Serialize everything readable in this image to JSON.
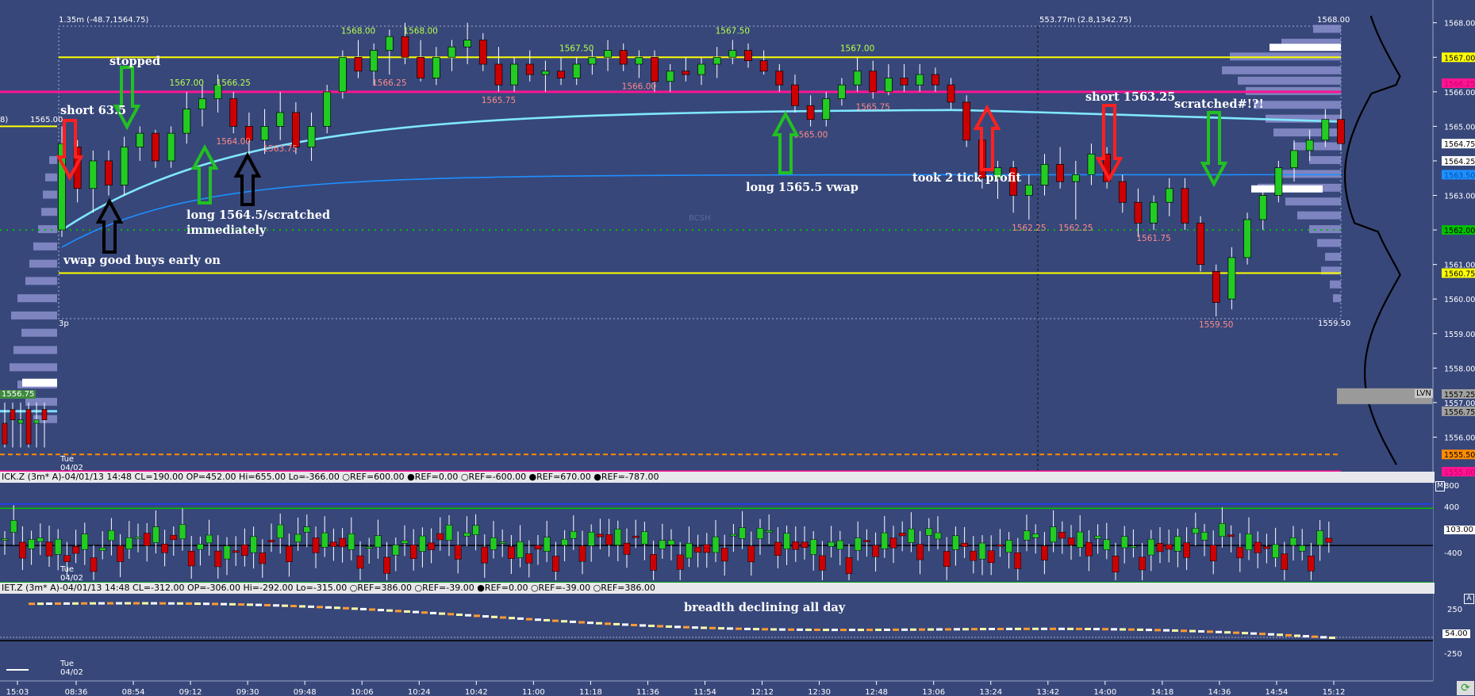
{
  "main_pane": {
    "top_left_text": "1.35m (-48.7,1564.75)",
    "top_mid_text": "553.77m (2.8,1342.75)",
    "top_right_label": "1568.00",
    "left_edge_label": "1565.00",
    "left_edge_label2": "8)",
    "bottom_right_label": "1559.50",
    "ghost_label": "BCSH",
    "date_label_day": "Tue",
    "date_label_date": "04/02",
    "three_p": "3p",
    "lvn_label": "LVN",
    "left_low_label": "1556.75"
  },
  "annotations": {
    "short_635": "short 63.5",
    "stopped": "stopped",
    "vwap_buys": "vwap good buys early on",
    "long_15645": "long 1564.5/scratched",
    "immediately": "immediately",
    "long_15655": "long 1565.5 vwap",
    "took_2_tick": "took 2 tick profit",
    "short_156325": "short 1563.25",
    "scratched": "scratched#!?!",
    "breadth": "breadth declining all day"
  },
  "tick_pane": {
    "info": "ICK.Z (3m* A)-04/01/13 14:48 CL=190.00 OP=452.00 Hi=655.00 Lo=-366.00  ○REF=600.00  ●REF=0.00  ○REF=-600.00  ●REF=670.00  ●REF=-787.00",
    "y_ticks": [
      "800",
      "400",
      "103.00",
      "-400"
    ],
    "day": "Tue",
    "date": "04/02"
  },
  "breadth_pane": {
    "info": "IET.Z (3m* A)-04/01/13 14:48 CL=-312.00 OP=-306.00 Hi=-292.00 Lo=-315.00  ○REF=386.00  ○REF=-39.00  ●REF=0.00  ○REF=-39.00  ○REF=386.00",
    "y_ticks": [
      "250",
      "-250",
      "54.00"
    ],
    "day": "Tue",
    "date": "04/02"
  },
  "price_axis": {
    "ticks": [
      "1568.00",
      "1567.00",
      "1566.00",
      "1565.00",
      "1564.00",
      "1563.00",
      "1562.00",
      "1561.00",
      "1560.00",
      "1559.00",
      "1558.00",
      "1557.00",
      "1556.00"
    ],
    "markers": [
      {
        "text": "1567.00",
        "bg": "#ffff00",
        "fg": "#000000",
        "price": 1567.0
      },
      {
        "text": "1566.25",
        "bg": "#ff1493",
        "fg": "#ff1493",
        "price": 1566.25
      },
      {
        "text": "1564.75",
        "bg": "#ffffff",
        "fg": "#000000",
        "price": 1564.5
      },
      {
        "text": "1564.25",
        "bg": "#ffffff",
        "fg": "#000000",
        "price": 1564.0
      },
      {
        "text": "1563.50",
        "bg": "#1e90ff",
        "fg": "#1e90ff",
        "price": 1563.6
      },
      {
        "text": "1562.00",
        "bg": "#00c000",
        "fg": "#000000",
        "price": 1562.0
      },
      {
        "text": "1560.75",
        "bg": "#ffff00",
        "fg": "#000000",
        "price": 1560.75
      },
      {
        "text": "1557.25",
        "bg": "#a0a0a0",
        "fg": "#000000",
        "price": 1557.25
      },
      {
        "text": "1556.75",
        "bg": "#a0a0a0",
        "fg": "#000000",
        "price": 1556.75
      },
      {
        "text": "1555.50",
        "bg": "#ff8c00",
        "fg": "#000000",
        "price": 1555.5
      },
      {
        "text": "1555.00",
        "bg": "#ff1493",
        "fg": "#ff1493",
        "price": 1555.0
      }
    ]
  },
  "chart_data": {
    "type": "candlestick",
    "x_tick_labels": [
      "15:03",
      "08:36",
      "08:54",
      "09:12",
      "09:30",
      "09:48",
      "10:06",
      "10:24",
      "10:42",
      "11:00",
      "11:18",
      "11:36",
      "11:54",
      "12:12",
      "12:30",
      "12:48",
      "13:06",
      "13:24",
      "13:42",
      "14:00",
      "14:18",
      "14:36",
      "14:54",
      "15:12"
    ],
    "price_range": [
      1555.0,
      1568.2
    ],
    "reference_lines": [
      {
        "price": 1567.0,
        "color": "#ffff00",
        "style": "solid"
      },
      {
        "price": 1566.0,
        "color": "#ff1493",
        "style": "solid"
      },
      {
        "price": 1560.75,
        "color": "#ffff00",
        "style": "solid"
      },
      {
        "price": 1562.0,
        "color": "#00c000",
        "style": "dotted"
      },
      {
        "price": 1555.5,
        "color": "#ff8c00",
        "style": "dashed"
      },
      {
        "price": 1555.0,
        "color": "#ff1493",
        "style": "solid"
      }
    ],
    "high_labels": [
      {
        "text": "1567.00",
        "bar": 8
      },
      {
        "text": "1566.25",
        "bar": 11
      },
      {
        "text": "1568.00",
        "bar": 19
      },
      {
        "text": "1568.00",
        "bar": 23
      },
      {
        "text": "1567.50",
        "bar": 33
      },
      {
        "text": "1567.50",
        "bar": 43
      },
      {
        "text": "1567.00",
        "bar": 51
      }
    ],
    "low_labels": [
      {
        "text": "1566.25",
        "bar": 21
      },
      {
        "text": "1565.75",
        "bar": 28
      },
      {
        "text": "1566.00",
        "bar": 37
      },
      {
        "text": "1565.00",
        "bar": 48
      },
      {
        "text": "1565.75",
        "bar": 52
      },
      {
        "text": "1564.00",
        "bar": 11
      },
      {
        "text": "1563.75",
        "bar": 14
      },
      {
        "text": "1562.25",
        "bar": 62
      },
      {
        "text": "1562.25",
        "bar": 65
      },
      {
        "text": "1561.75",
        "bar": 70
      },
      {
        "text": "1559.50",
        "bar": 74
      }
    ],
    "series": [
      {
        "name": "price",
        "ohlc": [
          [
            1562.0,
            1565.0,
            1561.8,
            1564.5
          ],
          [
            1564.4,
            1564.6,
            1562.8,
            1563.2
          ],
          [
            1563.2,
            1564.3,
            1562.5,
            1564.0
          ],
          [
            1564.0,
            1564.3,
            1563.0,
            1563.3
          ],
          [
            1563.3,
            1564.7,
            1563.0,
            1564.4
          ],
          [
            1564.4,
            1565.0,
            1564.0,
            1564.8
          ],
          [
            1564.8,
            1564.9,
            1563.8,
            1564.0
          ],
          [
            1564.0,
            1565.0,
            1563.8,
            1564.8
          ],
          [
            1564.8,
            1566.0,
            1564.5,
            1565.5
          ],
          [
            1565.5,
            1566.2,
            1565.0,
            1565.8
          ],
          [
            1565.8,
            1566.5,
            1565.4,
            1566.2
          ],
          [
            1565.8,
            1566.0,
            1564.8,
            1565.0
          ],
          [
            1565.0,
            1565.4,
            1564.0,
            1564.6
          ],
          [
            1564.6,
            1565.5,
            1564.2,
            1565.0
          ],
          [
            1565.0,
            1566.0,
            1564.6,
            1565.4
          ],
          [
            1565.4,
            1565.7,
            1564.2,
            1564.4
          ],
          [
            1564.4,
            1565.4,
            1564.0,
            1565.0
          ],
          [
            1565.0,
            1566.2,
            1564.8,
            1566.0
          ],
          [
            1566.0,
            1567.2,
            1565.8,
            1567.0
          ],
          [
            1567.0,
            1567.5,
            1566.4,
            1566.6
          ],
          [
            1566.6,
            1567.4,
            1566.2,
            1567.2
          ],
          [
            1567.2,
            1567.8,
            1566.5,
            1567.6
          ],
          [
            1567.6,
            1568.0,
            1566.8,
            1567.0
          ],
          [
            1567.0,
            1567.5,
            1566.3,
            1566.4
          ],
          [
            1566.4,
            1567.3,
            1566.2,
            1567.0
          ],
          [
            1567.0,
            1567.5,
            1566.6,
            1567.3
          ],
          [
            1567.3,
            1568.0,
            1566.8,
            1567.5
          ],
          [
            1567.5,
            1567.7,
            1566.6,
            1566.8
          ],
          [
            1566.8,
            1567.3,
            1566.0,
            1566.2
          ],
          [
            1566.2,
            1567.0,
            1566.0,
            1566.8
          ],
          [
            1566.8,
            1567.2,
            1566.3,
            1566.5
          ],
          [
            1566.5,
            1566.9,
            1566.0,
            1566.6
          ],
          [
            1566.6,
            1567.0,
            1566.2,
            1566.4
          ],
          [
            1566.4,
            1567.0,
            1566.2,
            1566.8
          ],
          [
            1566.8,
            1567.2,
            1566.5,
            1567.0
          ],
          [
            1567.0,
            1567.5,
            1566.6,
            1567.2
          ],
          [
            1567.2,
            1567.4,
            1566.6,
            1566.8
          ],
          [
            1566.8,
            1567.2,
            1566.4,
            1567.0
          ],
          [
            1567.0,
            1567.2,
            1566.0,
            1566.3
          ],
          [
            1566.3,
            1566.8,
            1566.0,
            1566.6
          ],
          [
            1566.6,
            1567.0,
            1566.3,
            1566.5
          ],
          [
            1566.5,
            1567.0,
            1566.2,
            1566.8
          ],
          [
            1566.8,
            1567.3,
            1566.4,
            1567.0
          ],
          [
            1567.0,
            1567.5,
            1566.8,
            1567.2
          ],
          [
            1567.2,
            1567.4,
            1566.7,
            1566.9
          ],
          [
            1566.9,
            1567.2,
            1566.5,
            1566.6
          ],
          [
            1566.6,
            1566.8,
            1566.0,
            1566.2
          ],
          [
            1566.2,
            1566.5,
            1565.4,
            1565.6
          ],
          [
            1565.6,
            1565.9,
            1565.0,
            1565.2
          ],
          [
            1565.2,
            1566.0,
            1565.0,
            1565.8
          ],
          [
            1565.8,
            1566.4,
            1565.6,
            1566.2
          ],
          [
            1566.2,
            1567.0,
            1566.0,
            1566.6
          ],
          [
            1566.6,
            1566.9,
            1565.8,
            1566.0
          ],
          [
            1566.0,
            1566.8,
            1565.9,
            1566.4
          ],
          [
            1566.4,
            1566.8,
            1566.0,
            1566.2
          ],
          [
            1566.2,
            1566.8,
            1566.0,
            1566.5
          ],
          [
            1566.5,
            1566.7,
            1566.0,
            1566.2
          ],
          [
            1566.2,
            1566.4,
            1565.5,
            1565.7
          ],
          [
            1565.7,
            1565.9,
            1564.4,
            1564.6
          ],
          [
            1564.6,
            1564.8,
            1563.2,
            1563.5
          ],
          [
            1563.5,
            1564.0,
            1562.9,
            1563.8
          ],
          [
            1563.8,
            1564.0,
            1562.5,
            1563.0
          ],
          [
            1563.0,
            1563.6,
            1562.3,
            1563.3
          ],
          [
            1563.3,
            1564.2,
            1563.0,
            1563.9
          ],
          [
            1563.9,
            1564.4,
            1563.2,
            1563.4
          ],
          [
            1563.4,
            1564.0,
            1562.3,
            1563.6
          ],
          [
            1563.6,
            1564.5,
            1563.3,
            1564.2
          ],
          [
            1564.2,
            1564.4,
            1563.2,
            1563.4
          ],
          [
            1563.4,
            1563.6,
            1562.5,
            1562.8
          ],
          [
            1562.8,
            1563.2,
            1561.8,
            1562.2
          ],
          [
            1562.2,
            1563.0,
            1562.0,
            1562.8
          ],
          [
            1562.8,
            1563.5,
            1562.4,
            1563.2
          ],
          [
            1563.2,
            1563.5,
            1562.0,
            1562.2
          ],
          [
            1562.2,
            1562.4,
            1560.8,
            1561.0
          ],
          [
            1560.8,
            1561.0,
            1559.5,
            1559.9
          ],
          [
            1560.0,
            1561.5,
            1559.7,
            1561.2
          ],
          [
            1561.2,
            1562.5,
            1561.0,
            1562.3
          ],
          [
            1562.3,
            1563.3,
            1562.0,
            1563.0
          ],
          [
            1563.0,
            1564.0,
            1562.8,
            1563.8
          ],
          [
            1563.8,
            1564.6,
            1563.4,
            1564.3
          ],
          [
            1564.3,
            1564.9,
            1564.0,
            1564.6
          ],
          [
            1564.6,
            1565.5,
            1564.4,
            1565.2
          ],
          [
            1565.2,
            1565.5,
            1564.3,
            1564.5
          ]
        ]
      }
    ]
  }
}
